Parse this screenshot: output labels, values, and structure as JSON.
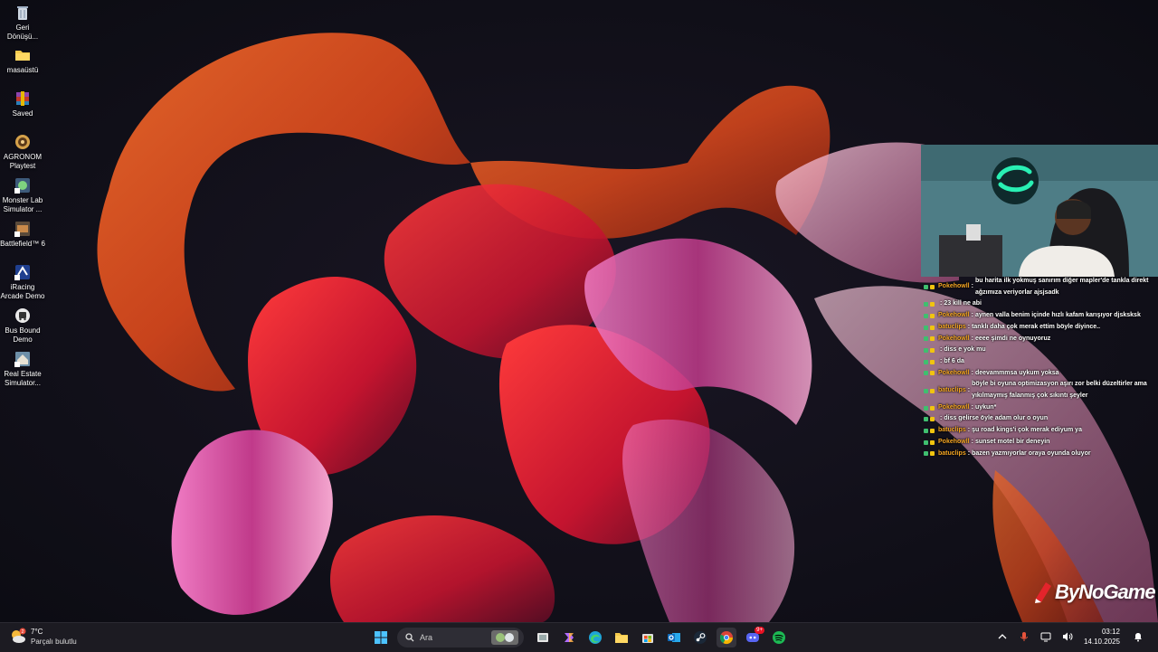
{
  "desktop": {
    "icons": [
      {
        "label": "Geri Dönüşü...",
        "icon": "recycle-bin-icon"
      },
      {
        "label": "masaüstü",
        "icon": "folder-icon"
      },
      {
        "label": "Saved",
        "icon": "winrar-archive-icon"
      },
      {
        "label": "AGRONOM Playtest",
        "icon": "agronom-icon"
      },
      {
        "label": "Monster Lab Simulator ...",
        "icon": "monster-lab-icon"
      },
      {
        "label": "Battlefield™ 6",
        "icon": "battlefield-icon"
      },
      {
        "label": "iRacing Arcade Demo",
        "icon": "iracing-icon"
      },
      {
        "label": "Bus Bound Demo",
        "icon": "bus-bound-icon"
      },
      {
        "label": "Real Estate Simulator...",
        "icon": "real-estate-icon"
      }
    ]
  },
  "chat": {
    "messages": [
      {
        "user": "Pokehowll",
        "text": "bu harita ilk yokmuş sanırım diğer mapler'de tankla direkt ağzımıza veriyorlar ajsjsadk",
        "color": "#f5a623"
      },
      {
        "user": "",
        "text": "23 kill ne abi",
        "color": "#e74c3c"
      },
      {
        "user": "Pokehowll",
        "text": "aynen valla benim içinde hızlı kafam karışıyor djsksksk",
        "color": "#f5a623"
      },
      {
        "user": "batuclips",
        "text": "tanklı daha çok merak ettim böyle diyince..",
        "color": "#f5a623"
      },
      {
        "user": "Pokehowll",
        "text": "eeee şimdi ne oynuyoruz",
        "color": "#f5a623"
      },
      {
        "user": "",
        "text": "diss e yok mu",
        "color": "#9b59b6"
      },
      {
        "user": "",
        "text": "bf 6 da",
        "color": "#9b59b6"
      },
      {
        "user": "Pokehowll",
        "text": "deevammmsa uykum yoksa",
        "color": "#f5a623"
      },
      {
        "user": "batuclips",
        "text": "böyle bi oyuna optimizasyon aşırı zor belki düzeltirler ama yıkılmaymış falanmış çok sıkıntı şeyler",
        "color": "#f5a623"
      },
      {
        "user": "Pokehowll",
        "text": "uykun*",
        "color": "#f5a623"
      },
      {
        "user": "",
        "text": "diss gelirse öyle adam olur o oyun",
        "color": "#e74c3c"
      },
      {
        "user": "batuclips",
        "text": "şu road kings'i çok merak ediyum ya",
        "color": "#f5a623"
      },
      {
        "user": "Pokehowll",
        "text": "sunset motel bir deneyin",
        "color": "#f5a623"
      },
      {
        "user": "batuclips",
        "text": "bazen yazmıyorlar oraya oyunda oluyor",
        "color": "#f5a623"
      }
    ]
  },
  "overlay": {
    "logo_text": "ByNoGame"
  },
  "taskbar": {
    "weather_temp": "7°C",
    "weather_condition": "Parçalı bulutlu",
    "search_placeholder": "Ara",
    "pinned": [
      "start-icon",
      "task-view-icon",
      "copilot-icon",
      "edge-icon",
      "file-explorer-icon",
      "store-icon",
      "outlook-icon",
      "steam-icon",
      "chrome-icon",
      "discord-icon",
      "spotify-icon"
    ],
    "discord_badge": "9+",
    "clock_time": "03:12",
    "clock_date": "14.10.2025"
  }
}
